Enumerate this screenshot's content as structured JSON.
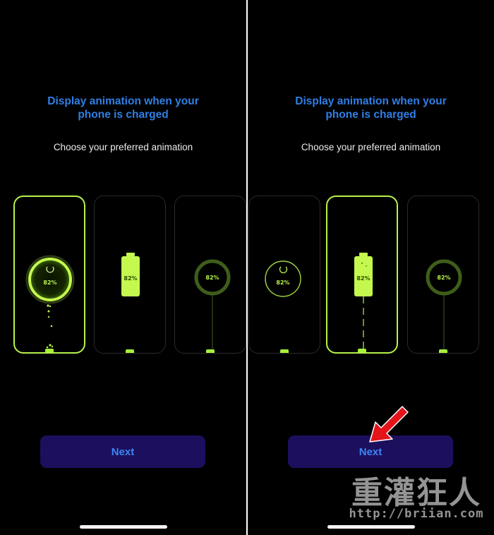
{
  "screens": [
    {
      "title_line1": "Display animation when your",
      "title_line2": "phone is charged",
      "subtitle": "Choose your preferred animation",
      "selected_option": 1,
      "options": [
        {
          "style": "ring-drops",
          "percent_label": "82%"
        },
        {
          "style": "battery",
          "percent_label": "82%"
        },
        {
          "style": "ring-line",
          "percent_label": "82%"
        }
      ],
      "next_label": "Next"
    },
    {
      "title_line1": "Display animation when your",
      "title_line2": "phone is charged",
      "subtitle": "Choose your preferred animation",
      "selected_option": 2,
      "options": [
        {
          "style": "ring",
          "percent_label": "82%"
        },
        {
          "style": "battery",
          "percent_label": "82%"
        },
        {
          "style": "ring-line",
          "percent_label": "82%"
        }
      ],
      "next_label": "Next"
    }
  ],
  "colors": {
    "accent_green": "#b7f24a",
    "title_blue": "#2f7fe6",
    "button_bg": "#1c0f5e",
    "button_text": "#3d86f4",
    "annotation_arrow": "#e4141b"
  },
  "annotation": {
    "icon": "red-arrow-pointer-icon"
  },
  "watermark": {
    "main_text": "重灌狂人",
    "url_text": "http://briian.com"
  }
}
